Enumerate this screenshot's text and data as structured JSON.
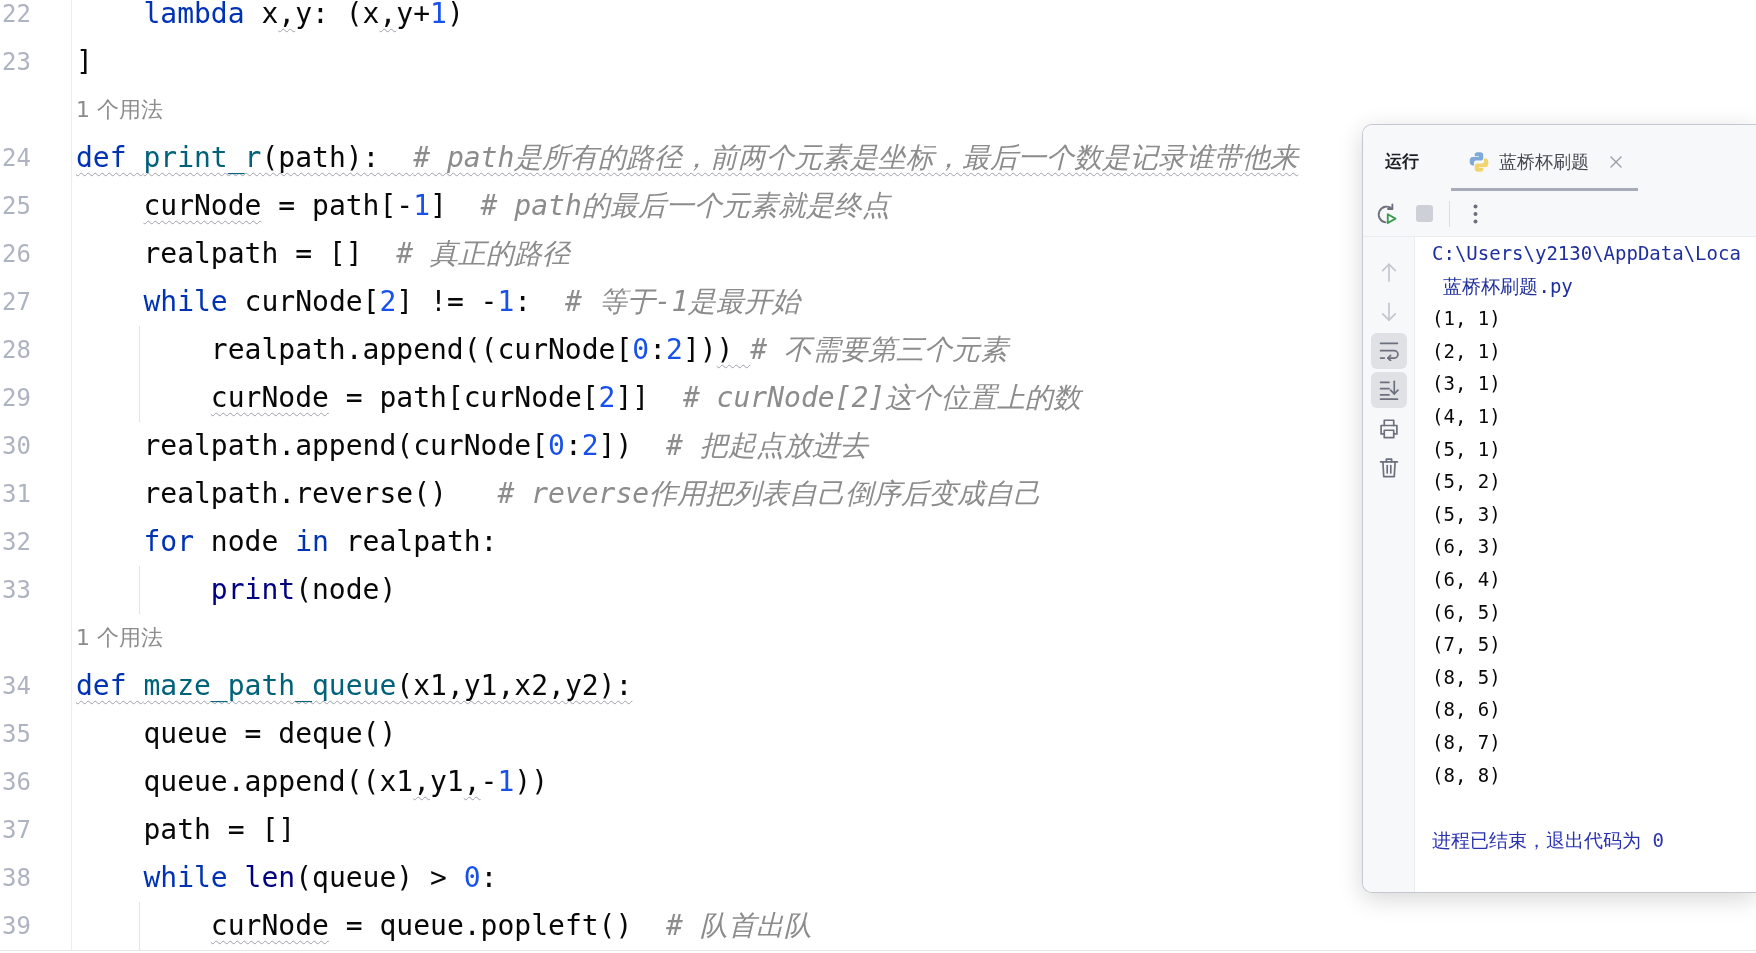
{
  "editor": {
    "lines": [
      {
        "kind": "code",
        "number": "22",
        "tokens": [
          {
            "kind": "keyword",
            "text": "    lambda",
            "wavy": false
          },
          {
            "kind": "plain",
            "text": " x",
            "wavy": false
          },
          {
            "kind": "plain",
            "text": ",",
            "wavy": true
          },
          {
            "kind": "plain",
            "text": "y: (x",
            "wavy": false
          },
          {
            "kind": "plain",
            "text": ",",
            "wavy": true
          },
          {
            "kind": "plain",
            "text": "y+",
            "wavy": false
          },
          {
            "kind": "number",
            "text": "1",
            "wavy": false
          },
          {
            "kind": "plain",
            "text": ")",
            "wavy": false
          }
        ]
      },
      {
        "kind": "code",
        "number": "23",
        "tokens": [
          {
            "kind": "plain",
            "text": "]",
            "wavy": false
          }
        ]
      },
      {
        "kind": "usage",
        "text": "1 个用法"
      },
      {
        "kind": "code",
        "number": "24",
        "tokens": [
          {
            "kind": "keyword",
            "text": "def ",
            "wavy": true
          },
          {
            "kind": "function",
            "text": "print_r",
            "wavy": true
          },
          {
            "kind": "plain",
            "text": "(path):  ",
            "wavy": true
          },
          {
            "kind": "comment",
            "text": "# path是所有的路径，前两个元素是坐标，最后一个数是记录谁带他来",
            "wavy": true
          }
        ]
      },
      {
        "kind": "code",
        "number": "25",
        "tokens": [
          {
            "kind": "plain",
            "text": "    curNode",
            "wavy": true
          },
          {
            "kind": "plain",
            "text": " = path[-",
            "wavy": false
          },
          {
            "kind": "number",
            "text": "1",
            "wavy": false
          },
          {
            "kind": "plain",
            "text": "]  ",
            "wavy": false
          },
          {
            "kind": "comment",
            "text": "# path的最后一个元素就是终点",
            "wavy": false
          }
        ]
      },
      {
        "kind": "code",
        "number": "26",
        "tokens": [
          {
            "kind": "plain",
            "text": "    realpath = []  ",
            "wavy": false
          },
          {
            "kind": "comment",
            "text": "# 真正的路径",
            "wavy": false
          }
        ]
      },
      {
        "kind": "code",
        "number": "27",
        "tokens": [
          {
            "kind": "keyword",
            "text": "    while",
            "wavy": false
          },
          {
            "kind": "plain",
            "text": " curNode[",
            "wavy": false
          },
          {
            "kind": "number",
            "text": "2",
            "wavy": false
          },
          {
            "kind": "plain",
            "text": "] != -",
            "wavy": false
          },
          {
            "kind": "number",
            "text": "1",
            "wavy": false
          },
          {
            "kind": "plain",
            "text": ":  ",
            "wavy": false
          },
          {
            "kind": "comment",
            "text": "# 等于-1是最开始",
            "wavy": false
          }
        ]
      },
      {
        "kind": "code",
        "number": "28",
        "tokens": [
          {
            "kind": "plain",
            "text": "        realpath.append((curNode[",
            "wavy": false
          },
          {
            "kind": "number",
            "text": "0",
            "wavy": false
          },
          {
            "kind": "plain",
            "text": ":",
            "wavy": false
          },
          {
            "kind": "number",
            "text": "2",
            "wavy": false
          },
          {
            "kind": "plain",
            "text": "])",
            "wavy": false
          },
          {
            "kind": "plain",
            "text": ") ",
            "wavy": true
          },
          {
            "kind": "comment",
            "text": "# 不需要第三个元素",
            "wavy": false
          }
        ]
      },
      {
        "kind": "code",
        "number": "29",
        "tokens": [
          {
            "kind": "plain",
            "text": "        curNode",
            "wavy": true
          },
          {
            "kind": "plain",
            "text": " = path[curNode[",
            "wavy": false
          },
          {
            "kind": "number",
            "text": "2",
            "wavy": false
          },
          {
            "kind": "plain",
            "text": "]]  ",
            "wavy": false
          },
          {
            "kind": "comment",
            "text": "# curNode[2]这个位置上的数",
            "wavy": false
          }
        ]
      },
      {
        "kind": "code",
        "number": "30",
        "tokens": [
          {
            "kind": "plain",
            "text": "    realpath.append(curNode[",
            "wavy": false
          },
          {
            "kind": "number",
            "text": "0",
            "wavy": false
          },
          {
            "kind": "plain",
            "text": ":",
            "wavy": false
          },
          {
            "kind": "number",
            "text": "2",
            "wavy": false
          },
          {
            "kind": "plain",
            "text": "])  ",
            "wavy": false
          },
          {
            "kind": "comment",
            "text": "# 把起点放进去",
            "wavy": false
          }
        ]
      },
      {
        "kind": "code",
        "number": "31",
        "tokens": [
          {
            "kind": "plain",
            "text": "    realpath.reverse()   ",
            "wavy": false
          },
          {
            "kind": "comment",
            "text": "# reverse作用把列表自己倒序后变成自己",
            "wavy": false
          }
        ]
      },
      {
        "kind": "code",
        "number": "32",
        "tokens": [
          {
            "kind": "keyword",
            "text": "    for",
            "wavy": false
          },
          {
            "kind": "plain",
            "text": " node ",
            "wavy": false
          },
          {
            "kind": "keyword",
            "text": "in",
            "wavy": false
          },
          {
            "kind": "plain",
            "text": " realpath:",
            "wavy": false
          }
        ]
      },
      {
        "kind": "code",
        "number": "33",
        "tokens": [
          {
            "kind": "builtin",
            "text": "        print",
            "wavy": false
          },
          {
            "kind": "plain",
            "text": "(node)",
            "wavy": false
          }
        ]
      },
      {
        "kind": "usage",
        "text": "1 个用法"
      },
      {
        "kind": "code",
        "number": "34",
        "tokens": [
          {
            "kind": "keyword",
            "text": "def ",
            "wavy": true
          },
          {
            "kind": "function",
            "text": "maze_path_queue",
            "wavy": true
          },
          {
            "kind": "plain",
            "text": "(x1,y1,x2,y2):",
            "wavy": true
          }
        ]
      },
      {
        "kind": "code",
        "number": "35",
        "tokens": [
          {
            "kind": "plain",
            "text": "    queue = deque()",
            "wavy": false
          }
        ]
      },
      {
        "kind": "code",
        "number": "36",
        "tokens": [
          {
            "kind": "plain",
            "text": "    queue.append((x1",
            "wavy": false
          },
          {
            "kind": "plain",
            "text": ",",
            "wavy": true
          },
          {
            "kind": "plain",
            "text": "y1",
            "wavy": false
          },
          {
            "kind": "plain",
            "text": ",",
            "wavy": true
          },
          {
            "kind": "plain",
            "text": "-",
            "wavy": false
          },
          {
            "kind": "number",
            "text": "1",
            "wavy": false
          },
          {
            "kind": "plain",
            "text": "))",
            "wavy": false
          }
        ]
      },
      {
        "kind": "code",
        "number": "37",
        "tokens": [
          {
            "kind": "plain",
            "text": "    path = []",
            "wavy": false
          }
        ]
      },
      {
        "kind": "code",
        "number": "38",
        "tokens": [
          {
            "kind": "keyword",
            "text": "    while ",
            "wavy": false
          },
          {
            "kind": "builtin",
            "text": "len",
            "wavy": false
          },
          {
            "kind": "plain",
            "text": "(queue) > ",
            "wavy": false
          },
          {
            "kind": "number",
            "text": "0",
            "wavy": false
          },
          {
            "kind": "plain",
            "text": ":",
            "wavy": false
          }
        ]
      },
      {
        "kind": "code",
        "number": "39",
        "tokens": [
          {
            "kind": "plain",
            "text": "        curNode",
            "wavy": true
          },
          {
            "kind": "plain",
            "text": " = queue.popleft()  ",
            "wavy": false
          },
          {
            "kind": "comment",
            "text": "# 队首出队",
            "wavy": false
          }
        ]
      }
    ]
  },
  "run_panel": {
    "title": "运行",
    "tabs": [
      {
        "label": "蓝桥杯刷题",
        "selected": true
      }
    ],
    "rerun": {
      "disabled": false
    },
    "stop": {
      "disabled": true
    },
    "side_tools": [
      {
        "disabled": true,
        "on": false
      },
      {
        "disabled": true,
        "on": false
      },
      {
        "disabled": false,
        "on": true
      },
      {
        "disabled": false,
        "on": true
      },
      {
        "disabled": false,
        "on": false
      },
      {
        "disabled": false,
        "on": false
      }
    ],
    "console": [
      {
        "kind": "system",
        "text": "C:\\Users\\y2130\\AppData\\Loca"
      },
      {
        "kind": "wrapped",
        "text": "蓝桥杯刷题.py"
      },
      {
        "kind": "output",
        "text": "(1, 1)"
      },
      {
        "kind": "output",
        "text": "(2, 1)"
      },
      {
        "kind": "output",
        "text": "(3, 1)"
      },
      {
        "kind": "output",
        "text": "(4, 1)"
      },
      {
        "kind": "output",
        "text": "(5, 1)"
      },
      {
        "kind": "output",
        "text": "(5, 2)"
      },
      {
        "kind": "output",
        "text": "(5, 3)"
      },
      {
        "kind": "output",
        "text": "(6, 3)"
      },
      {
        "kind": "output",
        "text": "(6, 4)"
      },
      {
        "kind": "output",
        "text": "(6, 5)"
      },
      {
        "kind": "output",
        "text": "(7, 5)"
      },
      {
        "kind": "output",
        "text": "(8, 5)"
      },
      {
        "kind": "output",
        "text": "(8, 6)"
      },
      {
        "kind": "output",
        "text": "(8, 7)"
      },
      {
        "kind": "output",
        "text": "(8, 8)"
      },
      {
        "kind": "exit",
        "text": "进程已结束，退出代码为 0"
      }
    ]
  }
}
